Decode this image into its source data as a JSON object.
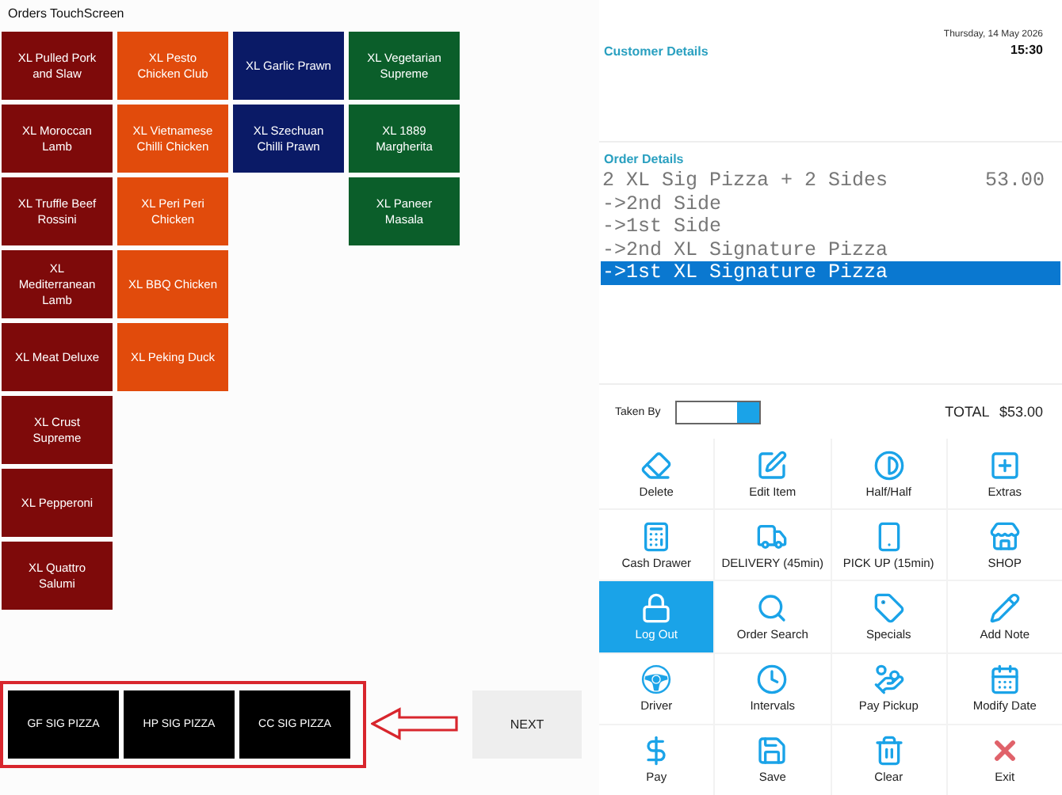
{
  "window": {
    "title": "Orders TouchScreen"
  },
  "menu_columns": [
    {
      "items": [
        {
          "label": "XL Pulled Pork and Slaw",
          "color": "#7e0a0a"
        },
        {
          "label": "XL Moroccan Lamb",
          "color": "#7e0a0a"
        },
        {
          "label": "XL Truffle Beef Rossini",
          "color": "#7e0a0a"
        },
        {
          "label": "XL Mediterranean Lamb",
          "color": "#7e0a0a"
        },
        {
          "label": "XL Meat Deluxe",
          "color": "#7e0a0a"
        },
        {
          "label": "XL Crust Supreme",
          "color": "#7e0a0a"
        },
        {
          "label": "XL Pepperoni",
          "color": "#7e0a0a"
        },
        {
          "label": "XL Quattro Salumi",
          "color": "#7e0a0a"
        }
      ]
    },
    {
      "items": [
        {
          "label": "XL Pesto Chicken Club",
          "color": "#e14b0c"
        },
        {
          "label": "XL Vietnamese Chilli Chicken",
          "color": "#e14b0c"
        },
        {
          "label": "XL Peri Peri Chicken",
          "color": "#e14b0c"
        },
        {
          "label": "XL BBQ Chicken",
          "color": "#e14b0c"
        },
        {
          "label": "XL Peking Duck",
          "color": "#e14b0c"
        }
      ]
    },
    {
      "items": [
        {
          "label": "XL Garlic Prawn",
          "color": "#0a1a66"
        },
        {
          "label": "XL Szechuan Chilli Prawn",
          "color": "#0a1a66"
        }
      ]
    },
    {
      "items": [
        {
          "label": "XL Vegetarian Supreme",
          "color": "#0b5e2a"
        },
        {
          "label": "XL 1889 Margherita",
          "color": "#0b5e2a"
        },
        {
          "label": "XL Paneer Masala",
          "color": "#0b5e2a"
        }
      ]
    }
  ],
  "categories": [
    "GF SIG PIZZA",
    "HP SIG PIZZA",
    "CC SIG PIZZA"
  ],
  "next_button": "NEXT",
  "customer_details": {
    "heading": "Customer Details",
    "date": "Thursday, 14 May 2026",
    "time": "15:30"
  },
  "order_details": {
    "heading": "Order Details",
    "lines": [
      {
        "text": "2 XL Sig Pizza + 2 Sides",
        "amount": "53.00",
        "selected": false
      },
      {
        "text": "->2nd Side",
        "selected": false
      },
      {
        "text": "->1st Side",
        "selected": false
      },
      {
        "text": "->2nd XL Signature Pizza",
        "selected": false
      },
      {
        "text": "->1st XL Signature Pizza",
        "selected": true
      }
    ]
  },
  "taken_by": {
    "label": "Taken By"
  },
  "total": {
    "label": "TOTAL",
    "value": "$53.00"
  },
  "actions": [
    {
      "label": "Delete",
      "selected": false
    },
    {
      "label": "Edit Item",
      "selected": false
    },
    {
      "label": "Half/Half",
      "selected": false
    },
    {
      "label": "Extras",
      "selected": false
    },
    {
      "label": "Cash Drawer",
      "selected": false
    },
    {
      "label": "DELIVERY (45min)",
      "selected": false
    },
    {
      "label": "PICK UP (15min)",
      "selected": false
    },
    {
      "label": "SHOP",
      "selected": false
    },
    {
      "label": "Log Out",
      "selected": true
    },
    {
      "label": "Order Search",
      "selected": false
    },
    {
      "label": "Specials",
      "selected": false
    },
    {
      "label": "Add Note",
      "selected": false
    },
    {
      "label": "Driver",
      "selected": false
    },
    {
      "label": "Intervals",
      "selected": false
    },
    {
      "label": "Pay Pickup",
      "selected": false
    },
    {
      "label": "Modify Date",
      "selected": false
    },
    {
      "label": "Pay",
      "selected": false
    },
    {
      "label": "Save",
      "selected": false
    },
    {
      "label": "Clear",
      "selected": false
    },
    {
      "label": "Exit",
      "selected": false
    }
  ]
}
